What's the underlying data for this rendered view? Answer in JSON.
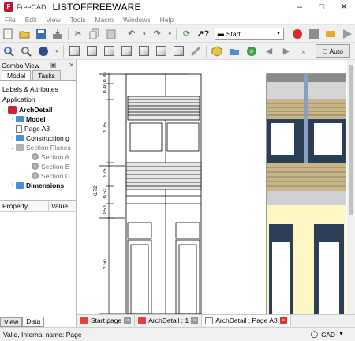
{
  "titlebar": {
    "app_name": "FreeCAD",
    "doc_title": "LISTOFFREEWARE"
  },
  "menu": [
    "File",
    "Edit",
    "View",
    "Tools",
    "Macro",
    "Windows",
    "Help"
  ],
  "toolbar": {
    "workbench": "Start",
    "nav_mode": "Auto"
  },
  "combo": {
    "title": "Combo View",
    "tabs": [
      "Model",
      "Tasks"
    ],
    "section": "Labels & Attributes",
    "root": "Application",
    "tree": {
      "archdetail": "ArchDetail",
      "model": "Model",
      "page": "Page A3",
      "construction": "Construction g",
      "section_planes": "Section Planes",
      "section_a": "Section A",
      "section_b": "Section B",
      "section_c": "Section C",
      "dimensions": "Dimensions"
    },
    "property_header": {
      "property": "Property",
      "value": "Value"
    },
    "bottom_tabs": [
      "View",
      "Data"
    ]
  },
  "drawing": {
    "dims": [
      "0.40",
      "0.30",
      "1.75",
      "0.75",
      "0.52",
      "0.50",
      "6.72",
      "2.50"
    ]
  },
  "doctabs": [
    {
      "label": "Start page"
    },
    {
      "label": "ArchDetail : 1"
    },
    {
      "label": "ArchDetail : Page A3"
    }
  ],
  "status": {
    "text": "Valid, Internal name: Page",
    "units": "CAD"
  }
}
